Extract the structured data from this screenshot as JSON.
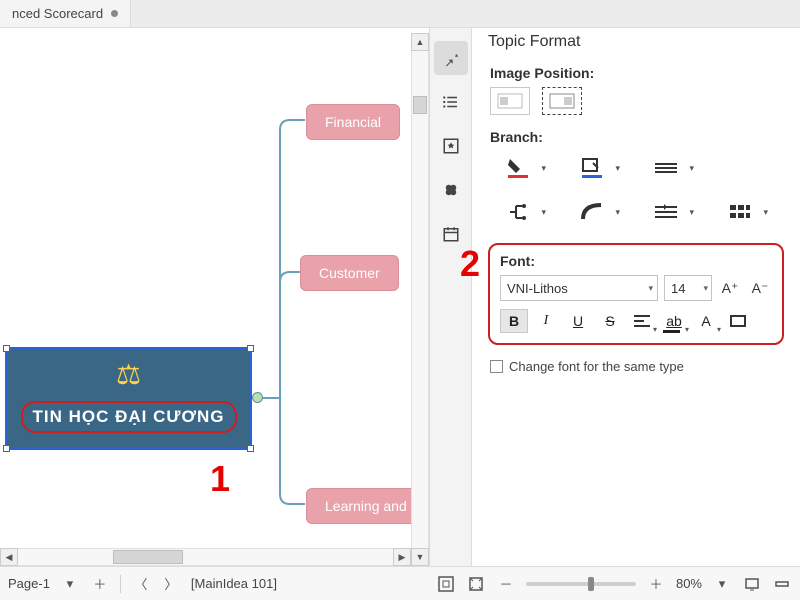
{
  "tab": {
    "label": "Balanced Scorecard",
    "truncated": "nced Scorecard"
  },
  "canvas": {
    "main_topic": "TIN HỌC ĐẠI CƯƠNG",
    "subtopics": [
      "Financial",
      "Customer",
      "Learning and"
    ],
    "callouts": [
      "1",
      "2"
    ]
  },
  "panel": {
    "title": "Topic Format",
    "image_position_label": "Image Position:",
    "branch_label": "Branch:",
    "font_label": "Font:",
    "font_name": "VNI-Lithos",
    "font_size": "14",
    "change_font_label": "Change font for the same type",
    "a_plus": "A⁺",
    "a_minus": "A⁻",
    "bold": "B",
    "italic": "I",
    "underline": "U",
    "strike": "S",
    "highlight": "ab",
    "textcolor": "A"
  },
  "rail_icons": [
    "pin",
    "list",
    "star-box",
    "clover",
    "calendar"
  ],
  "status": {
    "page": "Page-1",
    "breadcrumb": "[MainIdea 101]",
    "zoom": "80%"
  }
}
